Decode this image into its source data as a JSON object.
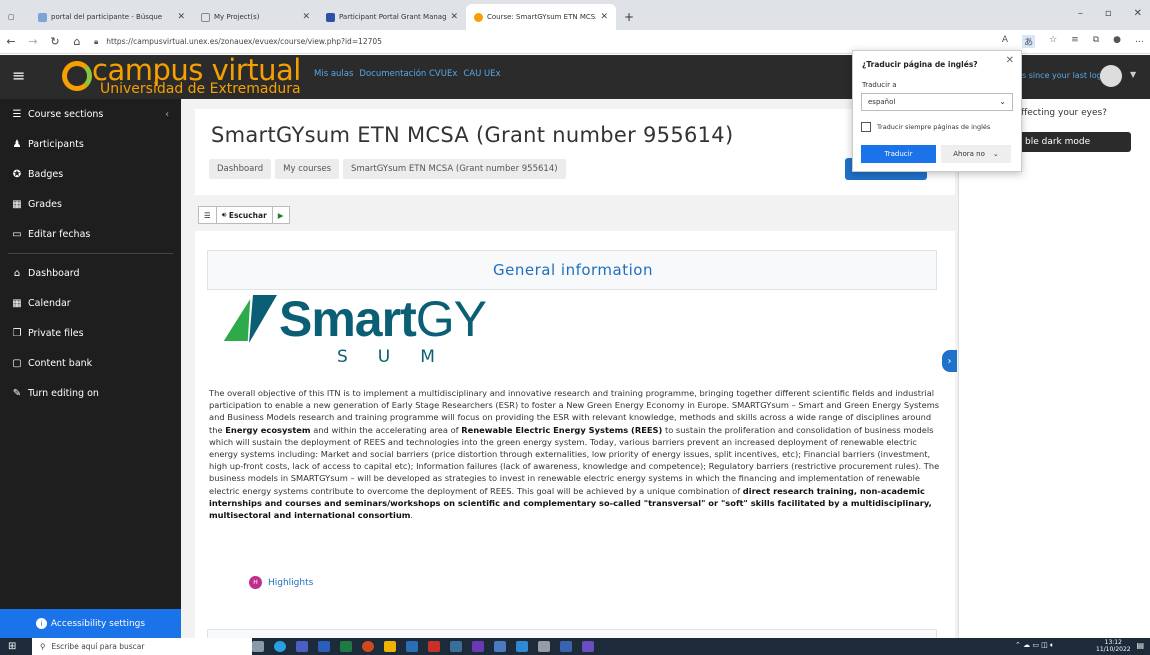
{
  "browser": {
    "tabs": [
      {
        "label": "portal del participante - Búsque",
        "active": false,
        "icon": "search-icon"
      },
      {
        "label": "My Project(s)",
        "active": false,
        "icon": "page-icon"
      },
      {
        "label": "Participant Portal Grant Manage",
        "active": false,
        "icon": "eu-icon"
      },
      {
        "label": "Course: SmartGYsum ETN MCSA",
        "active": true,
        "icon": "moodle-icon"
      }
    ],
    "new_tab": "+",
    "url": "https://campusvirtual.unex.es/zonauex/evuex/course/view.php?id=12705"
  },
  "site": {
    "logo_line1": "campus virtual",
    "logo_line2": "Universidad de Extremadura",
    "nav": [
      "Mis aulas",
      "Documentación CVUEx",
      "CAU UEx"
    ],
    "since_login": "s since your last login"
  },
  "sidebar": {
    "items": [
      {
        "label": "Course sections",
        "icon": "list-icon"
      },
      {
        "label": "Participants",
        "icon": "users-icon"
      },
      {
        "label": "Badges",
        "icon": "badge-icon"
      },
      {
        "label": "Grades",
        "icon": "grades-icon"
      },
      {
        "label": "Editar fechas",
        "icon": "calendar-edit-icon"
      }
    ],
    "items2": [
      {
        "label": "Dashboard",
        "icon": "home-icon"
      },
      {
        "label": "Calendar",
        "icon": "calendar-icon"
      },
      {
        "label": "Private files",
        "icon": "files-icon"
      },
      {
        "label": "Content bank",
        "icon": "bank-icon"
      },
      {
        "label": "Turn editing on",
        "icon": "pencil-icon"
      }
    ],
    "accessibility": "Accessibility settings"
  },
  "course": {
    "title": "SmartGYsum ETN MCSA (Grant number 955614)",
    "breadcrumbs": [
      "Dashboard",
      "My courses",
      "SmartGYsum ETN MCSA (Grant number 955614)"
    ],
    "readspeaker": "Escuchar",
    "section_title": "General information",
    "logo_text": "Smart",
    "logo_text2": "GY",
    "logo_sub": "SUM",
    "para_1": "The overall objective of this ITN is to implement a multidisciplinary and innovative research and training programme, bringing together different scientific fields and industrial participation to enable a new generation of Early Stage Researchers (ESR) to foster a New Green Energy Economy in Europe. SMARTGYsum – Smart and Green Energy Systems and Business Models research and training programme will focus on providing the ESR with relevant knowledge, methods and skills across a wide range of disciplines around the",
    "para_b1": "Energy ecosystem",
    "para_2": "and within the accelerating area of",
    "para_b2": "Renewable Electric Energy Systems (REES)",
    "para_3": "to sustain the proliferation and consolidation of business models which will sustain the deployment of REES and technologies into the green energy system. Today, various barriers prevent an increased deployment of renewable electric energy systems including: Market and social barriers (price distortion through externalities, low priority of energy issues, split incentives, etc); Financial barriers (investment, high up-front costs, lack of access to capital etc); Information failures (lack of awareness, knowledge and competence); Regulatory barriers (restrictive procurement rules). The business models in SMARTGYsum – will be developed as strategies to invest in renewable electric energy systems in which the financing and implementation of renewable electric energy systems contribute to overcome the deployment of REES. This goal will be achieved by a unique combination of",
    "para_b3": "direct research training, non-academic internships and courses and seminars/workshops on scientific and complementary so-called \"transversal\" or \"soft\" skills facilitated by a multidisciplinary, multisectoral and international consortium",
    "para_end": ".",
    "highlights": "Highlights"
  },
  "right_panel": {
    "question": "ffecting your eyes?",
    "dark_mode": "ble dark mode"
  },
  "translate_popup": {
    "title": "¿Traducir página de inglés?",
    "label": "Traducir a",
    "selected": "español",
    "checkbox": "Traducir siempre páginas de inglés",
    "translate_btn": "Traducir",
    "not_now": "Ahora no"
  },
  "taskbar": {
    "search": "Escribe aquí para buscar",
    "time": "13:12",
    "date": "11/10/2022"
  }
}
